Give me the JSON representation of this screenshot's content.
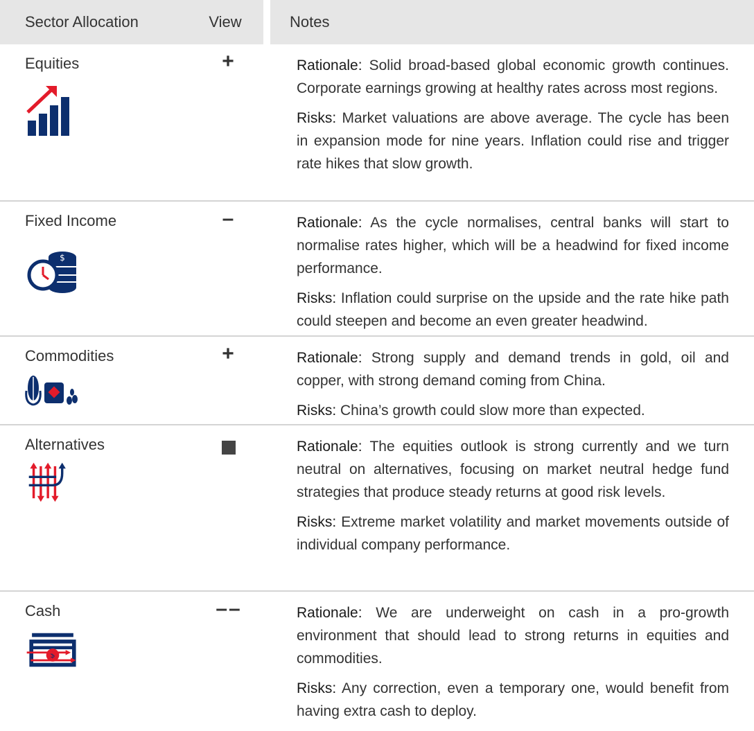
{
  "header": {
    "col1": "Sector Allocation",
    "col2": "View",
    "col3": "Notes"
  },
  "colors": {
    "navy": "#0d2f6e",
    "red": "#e31b2a",
    "header_bg": "#e6e6e6",
    "divider": "#d4d4d4"
  },
  "rows": [
    {
      "name": "Equities",
      "view": "+",
      "icon": "rising-bar-chart-icon",
      "rationale_label": "Rationale:",
      "rationale": "Solid broad-based global economic growth continues. Corporate earnings growing at healthy rates across most regions.",
      "risks_label": "Risks:",
      "risks": "Market valuations are above average. The cycle has been in expansion mode for nine years. Inflation could rise and trigger rate hikes that slow growth."
    },
    {
      "name": "Fixed Income",
      "view": "–",
      "icon": "clock-coins-icon",
      "rationale_label": "Rationale:",
      "rationale": "As the cycle normalises, central banks will start to normalise rates higher, which will be a headwind for fixed income performance.",
      "risks_label": "Risks:",
      "risks": "Inflation could surprise on the upside and the rate hike path could steepen and become an even greater headwind."
    },
    {
      "name": "Commodities",
      "view": "+",
      "icon": "corn-sack-beans-icon",
      "rationale_label": "Rationale:",
      "rationale": "Strong supply and demand trends in gold, oil and copper, with strong demand coming from China.",
      "risks_label": "Risks:",
      "risks": "China’s growth could slow more than expected."
    },
    {
      "name": "Alternatives",
      "view": "■",
      "icon": "diverging-arrows-icon",
      "rationale_label": "Rationale:",
      "rationale": "The equities outlook is strong currently and we turn neutral on alternatives, focusing on market neutral hedge fund strategies that produce steady returns at good risk levels.",
      "risks_label": "Risks:",
      "risks": "Extreme market volatility and market movements outside of individual company performance."
    },
    {
      "name": "Cash",
      "view": "––",
      "icon": "cash-notes-icon",
      "rationale_label": "Rationale:",
      "rationale": "We are underweight on cash in a pro-growth environment that should lead to strong returns in equities and commodities.",
      "risks_label": "Risks:",
      "risks": "Any correction, even a temporary one, would benefit from having extra cash to deploy."
    }
  ]
}
